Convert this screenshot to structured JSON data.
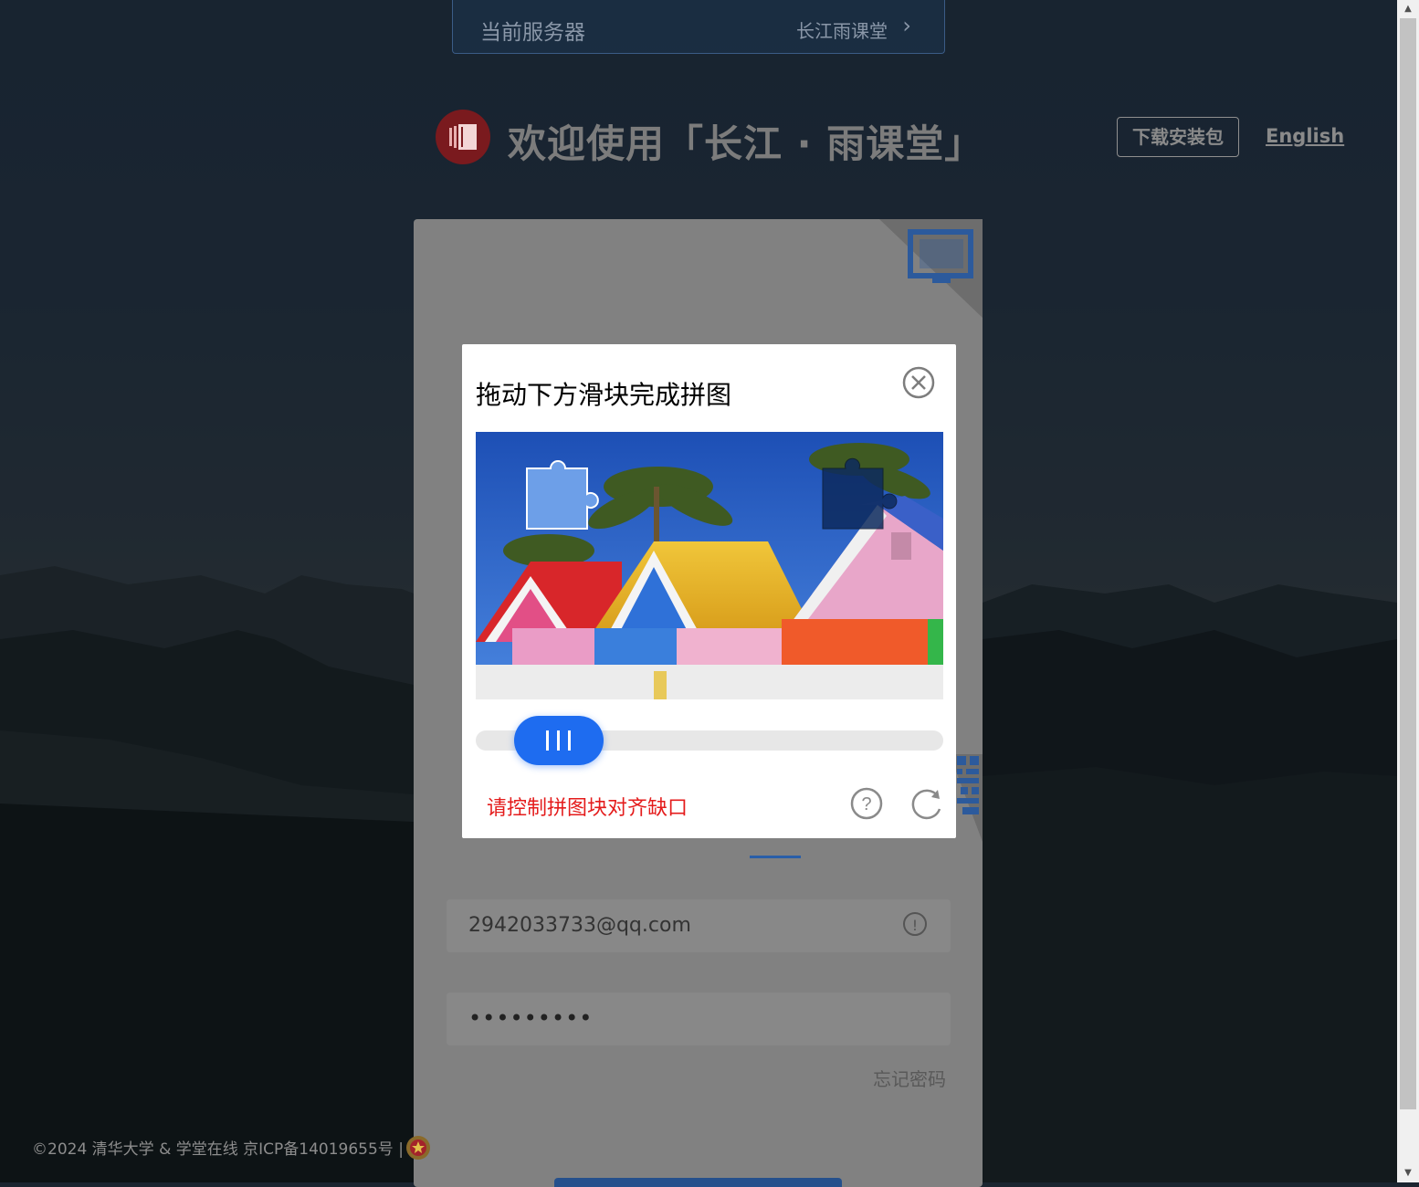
{
  "server": {
    "label": "当前服务器",
    "value": "长江雨课堂"
  },
  "header": {
    "welcome": "欢迎使用「长江 · 雨课堂」",
    "download": "下载安装包",
    "language": "English"
  },
  "login": {
    "account_value": "2942033733@qq.com",
    "password_mask": "•••••••••",
    "forgot": "忘记密码"
  },
  "captcha": {
    "title": "拖动下方滑块完成拼图",
    "hint": "请控制拼图块对齐缺口"
  },
  "footer": {
    "copyright": "©2024 清华大学 & 学堂在线",
    "icp": "京ICP备14019655号 |"
  },
  "colors": {
    "accent": "#1e6cf0",
    "error": "#e41c1c",
    "brand": "#7a1a1e"
  }
}
